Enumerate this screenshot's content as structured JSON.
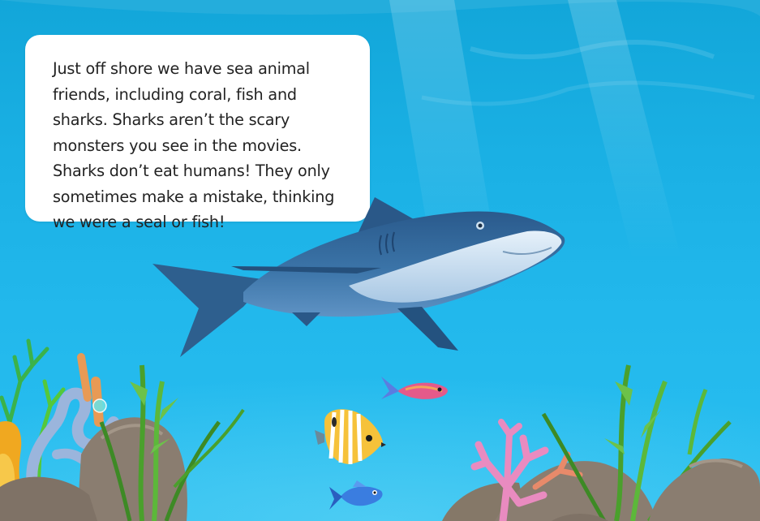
{
  "narration": {
    "text": "Just off shore we have sea animal friends, including coral, fish and sharks. Sharks aren’t the scary monsters you see in the movies. Sharks don’t eat humans! They only sometimes make a mistake, thinking we were a seal or fish!"
  },
  "colors": {
    "water_top": "#12a6d9",
    "water_bottom": "#29bff0",
    "bubble_bg": "#ffffff",
    "shark_back": "#2e5f8e",
    "shark_belly": "#c9def0",
    "rock": "#8a7d70",
    "seaweed": "#4aa02c",
    "coral_pink": "#e98bc0",
    "coral_blue": "#8fb4d8",
    "coral_orange": "#e88a4a"
  },
  "characters": [
    {
      "name": "shark",
      "icon": "shark-icon"
    },
    {
      "name": "pink-fish",
      "icon": "fish-icon"
    },
    {
      "name": "butterflyfish",
      "icon": "fish-icon"
    },
    {
      "name": "blue-fish",
      "icon": "fish-icon"
    }
  ]
}
